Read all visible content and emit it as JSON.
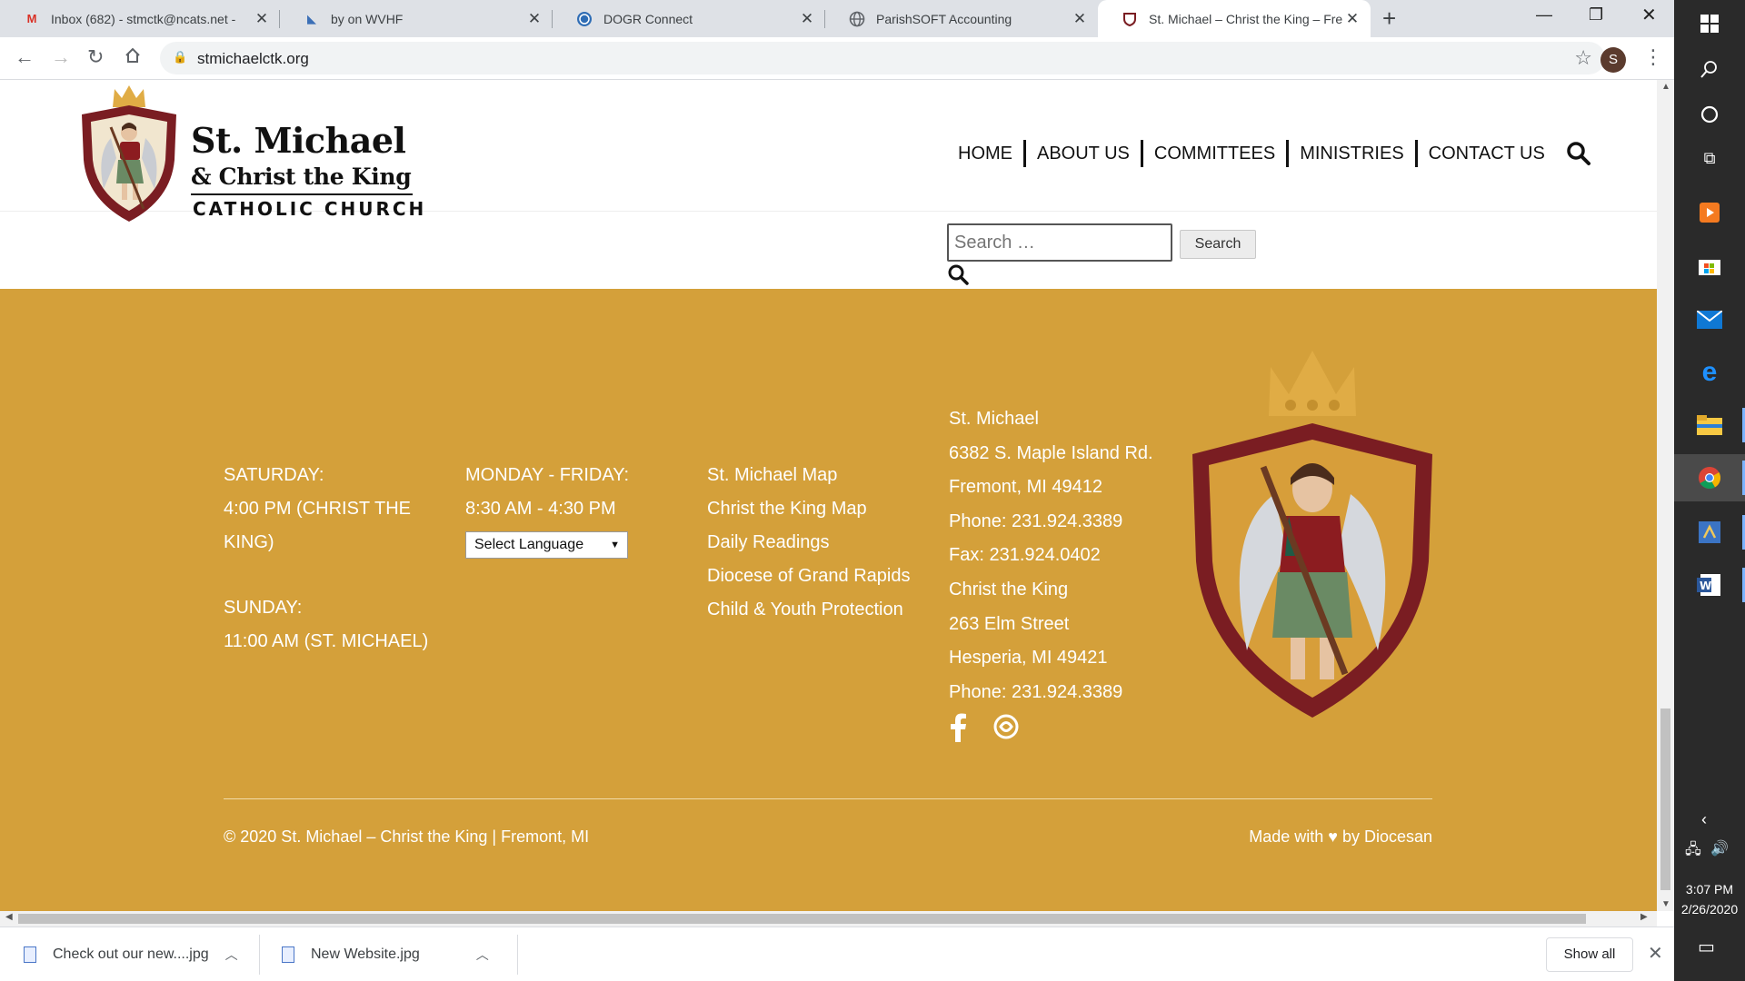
{
  "browser": {
    "tabs": [
      {
        "title": "Inbox (682) - stmctk@ncats.net -",
        "icon": "gmail-icon"
      },
      {
        "title": "by on WVHF",
        "icon": "wvhf-icon"
      },
      {
        "title": "DOGR Connect",
        "icon": "dogr-icon"
      },
      {
        "title": "ParishSOFT Accounting",
        "icon": "globe-icon"
      },
      {
        "title": "St. Michael – Christ the King – Fre",
        "icon": "crest-icon"
      }
    ],
    "url": "stmichaelctk.org",
    "profile_initial": "S"
  },
  "header": {
    "logo_line1": "St. Michael",
    "logo_line2": "& Christ the King",
    "logo_line3": "CATHOLIC CHURCH",
    "nav": [
      "HOME",
      "ABOUT US",
      "COMMITTEES",
      "MINISTRIES",
      "CONTACT US"
    ]
  },
  "search": {
    "placeholder": "Search …",
    "button_label": "Search"
  },
  "footer": {
    "masses": [
      {
        "day": "SATURDAY:",
        "time_line1": "4:00 PM (CHRIST THE",
        "time_line2": "KING)"
      },
      {
        "day": "SUNDAY:",
        "time": "11:00 AM (ST. MICHAEL)"
      }
    ],
    "office": {
      "days": "MONDAY - FRIDAY:",
      "hours": "8:30 AM - 4:30 PM",
      "language_select": "Select Language"
    },
    "links": [
      "St. Michael Map",
      "Christ the King Map",
      "Daily Readings",
      "Diocese of Grand Rapids",
      "Child & Youth Protection"
    ],
    "contact": [
      "St. Michael",
      "6382 S. Maple Island Rd.",
      "Fremont, MI 49412",
      "Phone: 231.924.3389",
      "Fax: 231.924.0402",
      "Christ the King",
      "263 Elm Street",
      "Hesperia, MI 49421",
      "Phone: 231.924.3389"
    ],
    "copyright": "© 2020 St. Michael – Christ the King | Fremont, MI",
    "made_with": "Made with ♥ by Diocesan",
    "colors": {
      "background": "#d4a03a",
      "crest_maroon": "#7a1d22"
    }
  },
  "downloads": [
    {
      "name": "Check out our new....jpg"
    },
    {
      "name": "New Website.jpg"
    }
  ],
  "downloads_show_all": "Show all",
  "taskbar": {
    "time": "3:07 PM",
    "date": "2/26/2020"
  }
}
